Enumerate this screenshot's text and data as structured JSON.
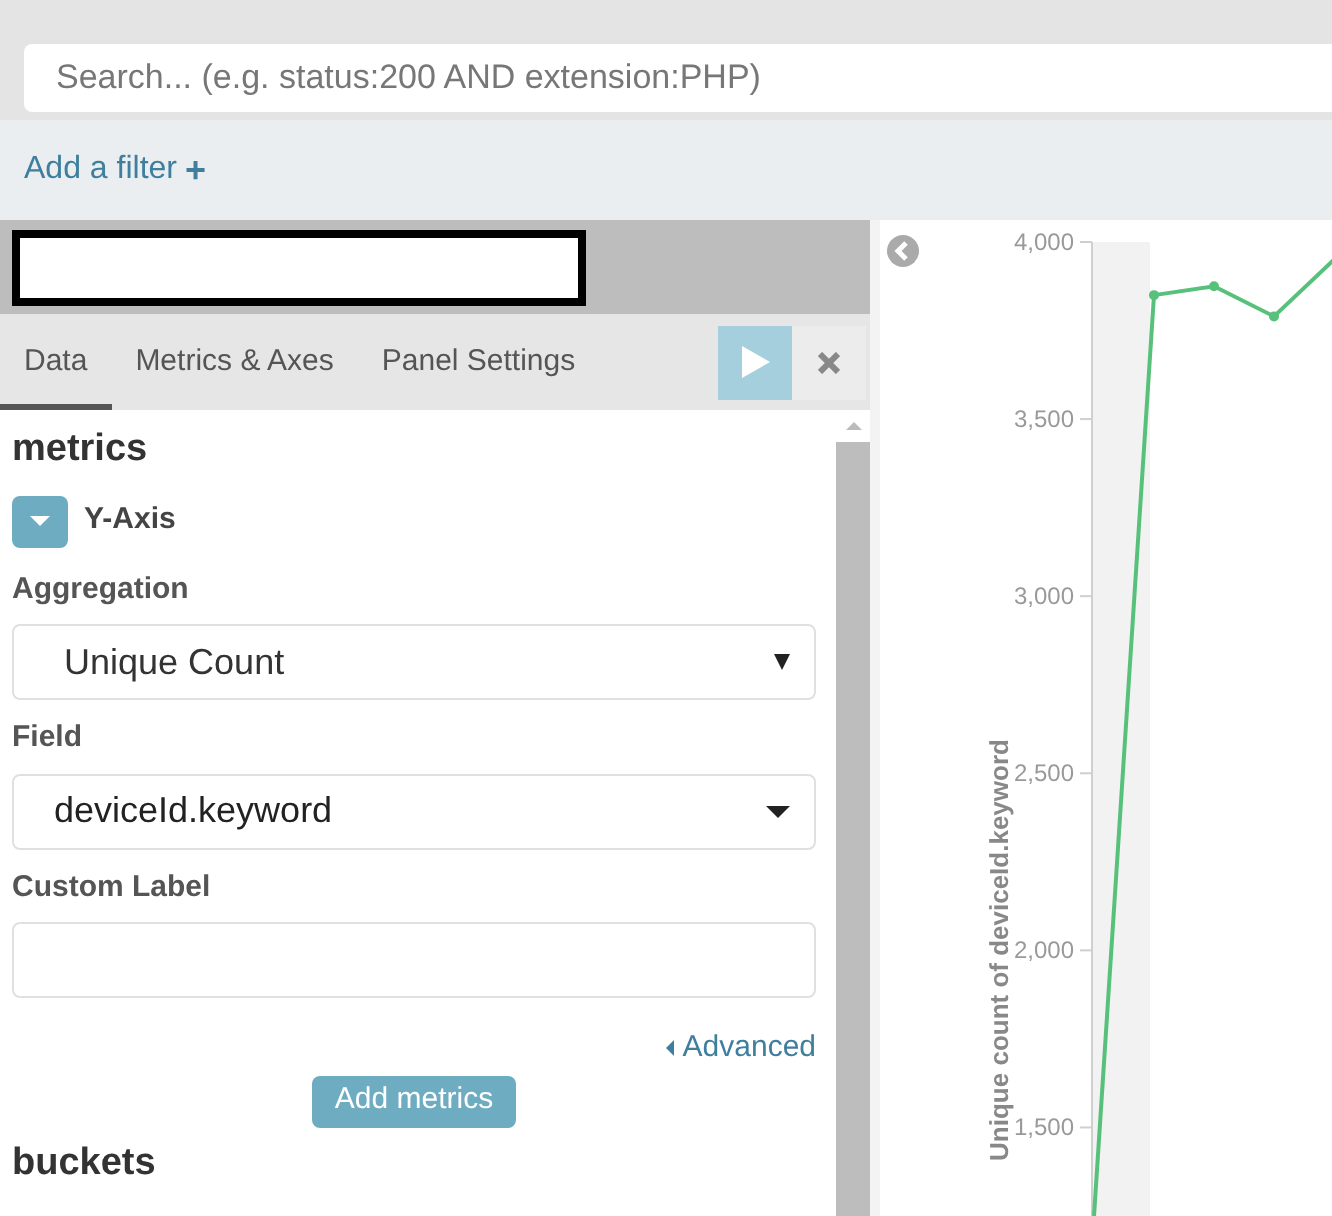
{
  "search": {
    "placeholder": "Search... (e.g. status:200 AND extension:PHP)"
  },
  "filter_link": {
    "label": "Add a filter",
    "icon": "+"
  },
  "tabs": [
    {
      "label": "Data",
      "selected": true
    },
    {
      "label": "Metrics & Axes",
      "selected": false
    },
    {
      "label": "Panel Settings",
      "selected": false
    }
  ],
  "metrics": {
    "heading": "metrics",
    "agg_label": "Y-Axis",
    "expanded": true,
    "fields": [
      {
        "kind": "select",
        "label": "Aggregation",
        "value": "Unique Count"
      },
      {
        "kind": "combo",
        "label": "Field",
        "value": "deviceId.keyword"
      },
      {
        "kind": "text",
        "label": "Custom Label"
      }
    ],
    "advanced": "Advanced",
    "add_button": "Add metrics"
  },
  "buckets": {
    "heading": "buckets"
  },
  "chart": {
    "chart_data": {
      "type": "line",
      "ylabel": "Unique count of deviceId.keyword",
      "ylim": [
        1250,
        4000
      ],
      "yticks": [
        {
          "value": 1500,
          "label": "1,500"
        },
        {
          "value": 2000,
          "label": "2,000"
        },
        {
          "value": 2500,
          "label": "2,500"
        },
        {
          "value": 3000,
          "label": "3,000"
        },
        {
          "value": 3500,
          "label": "3,500"
        },
        {
          "value": 4000,
          "label": "4,000"
        }
      ],
      "series": [
        {
          "color": "#57c17b",
          "values": [
            1250,
            3850,
            3875,
            3790,
            3950
          ]
        }
      ]
    }
  }
}
